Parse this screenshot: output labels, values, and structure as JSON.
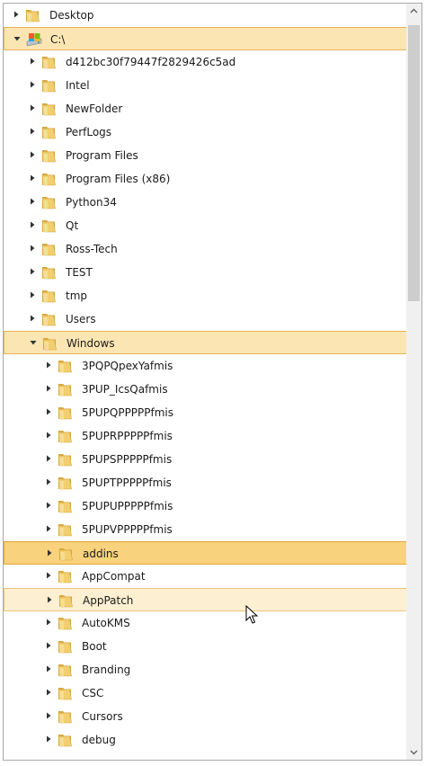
{
  "tree": {
    "items": [
      {
        "label": "Desktop",
        "level": 0,
        "expanded": false,
        "icon": "folder-icon",
        "state": ""
      },
      {
        "label": "C:\\",
        "level": 0,
        "expanded": true,
        "icon": "drive-icon",
        "state": "sel"
      },
      {
        "label": "d412bc30f79447f2829426c5ad",
        "level": 1,
        "expanded": false,
        "icon": "folder-icon",
        "state": ""
      },
      {
        "label": "Intel",
        "level": 1,
        "expanded": false,
        "icon": "folder-icon",
        "state": ""
      },
      {
        "label": "NewFolder",
        "level": 1,
        "expanded": false,
        "icon": "folder-icon",
        "state": ""
      },
      {
        "label": "PerfLogs",
        "level": 1,
        "expanded": false,
        "icon": "folder-icon",
        "state": ""
      },
      {
        "label": "Program Files",
        "level": 1,
        "expanded": false,
        "icon": "folder-icon",
        "state": ""
      },
      {
        "label": "Program Files (x86)",
        "level": 1,
        "expanded": false,
        "icon": "folder-icon",
        "state": ""
      },
      {
        "label": "Python34",
        "level": 1,
        "expanded": false,
        "icon": "folder-icon",
        "state": ""
      },
      {
        "label": "Qt",
        "level": 1,
        "expanded": false,
        "icon": "folder-icon",
        "state": ""
      },
      {
        "label": "Ross-Tech",
        "level": 1,
        "expanded": false,
        "icon": "folder-icon",
        "state": ""
      },
      {
        "label": "TEST",
        "level": 1,
        "expanded": false,
        "icon": "folder-icon",
        "state": ""
      },
      {
        "label": "tmp",
        "level": 1,
        "expanded": false,
        "icon": "folder-icon",
        "state": ""
      },
      {
        "label": "Users",
        "level": 1,
        "expanded": false,
        "icon": "folder-icon",
        "state": ""
      },
      {
        "label": "Windows",
        "level": 1,
        "expanded": true,
        "icon": "folder-icon",
        "state": "sel"
      },
      {
        "label": "3PQPQpexYafmis",
        "level": 2,
        "expanded": false,
        "icon": "folder-icon",
        "state": ""
      },
      {
        "label": "3PUP_IcsQafmis",
        "level": 2,
        "expanded": false,
        "icon": "folder-icon",
        "state": ""
      },
      {
        "label": "5PUPQPPPPPfmis",
        "level": 2,
        "expanded": false,
        "icon": "folder-icon",
        "state": ""
      },
      {
        "label": "5PUPRPPPPPfmis",
        "level": 2,
        "expanded": false,
        "icon": "folder-icon",
        "state": ""
      },
      {
        "label": "5PUPSPPPPPfmis",
        "level": 2,
        "expanded": false,
        "icon": "folder-icon",
        "state": ""
      },
      {
        "label": "5PUPTPPPPPfmis",
        "level": 2,
        "expanded": false,
        "icon": "folder-icon",
        "state": ""
      },
      {
        "label": "5PUPUPPPPPfmis",
        "level": 2,
        "expanded": false,
        "icon": "folder-icon",
        "state": ""
      },
      {
        "label": "5PUPVPPPPPfmis",
        "level": 2,
        "expanded": false,
        "icon": "folder-icon",
        "state": ""
      },
      {
        "label": "addins",
        "level": 2,
        "expanded": false,
        "icon": "folder-icon",
        "state": "selfocus"
      },
      {
        "label": "AppCompat",
        "level": 2,
        "expanded": false,
        "icon": "folder-icon",
        "state": ""
      },
      {
        "label": "AppPatch",
        "level": 2,
        "expanded": false,
        "icon": "folder-icon",
        "state": "hover"
      },
      {
        "label": "AutoKMS",
        "level": 2,
        "expanded": false,
        "icon": "folder-icon",
        "state": ""
      },
      {
        "label": "Boot",
        "level": 2,
        "expanded": false,
        "icon": "folder-icon",
        "state": ""
      },
      {
        "label": "Branding",
        "level": 2,
        "expanded": false,
        "icon": "folder-icon",
        "state": ""
      },
      {
        "label": "CSC",
        "level": 2,
        "expanded": false,
        "icon": "folder-icon",
        "state": ""
      },
      {
        "label": "Cursors",
        "level": 2,
        "expanded": false,
        "icon": "folder-icon",
        "state": ""
      },
      {
        "label": "debug",
        "level": 2,
        "expanded": false,
        "icon": "folder-icon",
        "state": ""
      }
    ]
  },
  "scrollbar": {
    "position_fraction": 0.0,
    "icon_up": "chevron-up-icon",
    "icon_down": "chevron-down-icon"
  },
  "colors": {
    "selection_bg": "#fbe6b3",
    "selection_border": "#e8b25a",
    "hover_bg": "#fdf0d2",
    "focus_bg": "#f8d27c",
    "folder": "#e8c15a"
  }
}
